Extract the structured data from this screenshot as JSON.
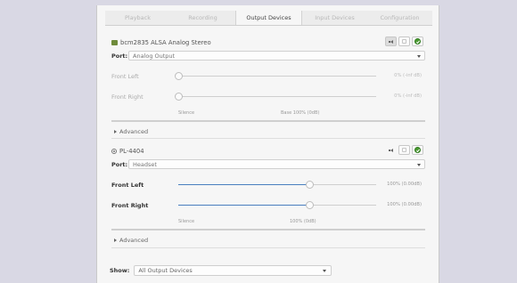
{
  "tabs": [
    {
      "label": "Playback",
      "active": false
    },
    {
      "label": "Recording",
      "active": false
    },
    {
      "label": "Output Devices",
      "active": true
    },
    {
      "label": "Input Devices",
      "active": false
    },
    {
      "label": "Configuration",
      "active": false
    }
  ],
  "devices": [
    {
      "name": "bcm2835 ALSA Analog Stereo",
      "icon": "sound-card-icon",
      "port_label": "Port:",
      "port_value": "Analog Output",
      "channels": [
        {
          "label": "Front Left",
          "value_text": "0% (-inf dB)",
          "level": 0
        },
        {
          "label": "Front Right",
          "value_text": "0% (-inf dB)",
          "level": 0
        }
      ],
      "scale": {
        "left": "Silence",
        "mid": "Base 100% (0dB)"
      },
      "advanced_label": "Advanced"
    },
    {
      "name": "PL-4404",
      "icon": "headset-icon",
      "port_label": "Port:",
      "port_value": "Headset",
      "channels": [
        {
          "label": "Front Left",
          "value_text": "100% (0.00dB)",
          "level": 1.0
        },
        {
          "label": "Front Right",
          "value_text": "100% (0.00dB)",
          "level": 1.0
        }
      ],
      "scale": {
        "left": "Silence",
        "mid": "100% (0dB)"
      },
      "advanced_label": "Advanced"
    }
  ],
  "footer": {
    "show_label": "Show:",
    "show_value": "All Output Devices"
  },
  "colors": {
    "accent": "#4a7fbf",
    "default_green": "#4c9a32"
  }
}
